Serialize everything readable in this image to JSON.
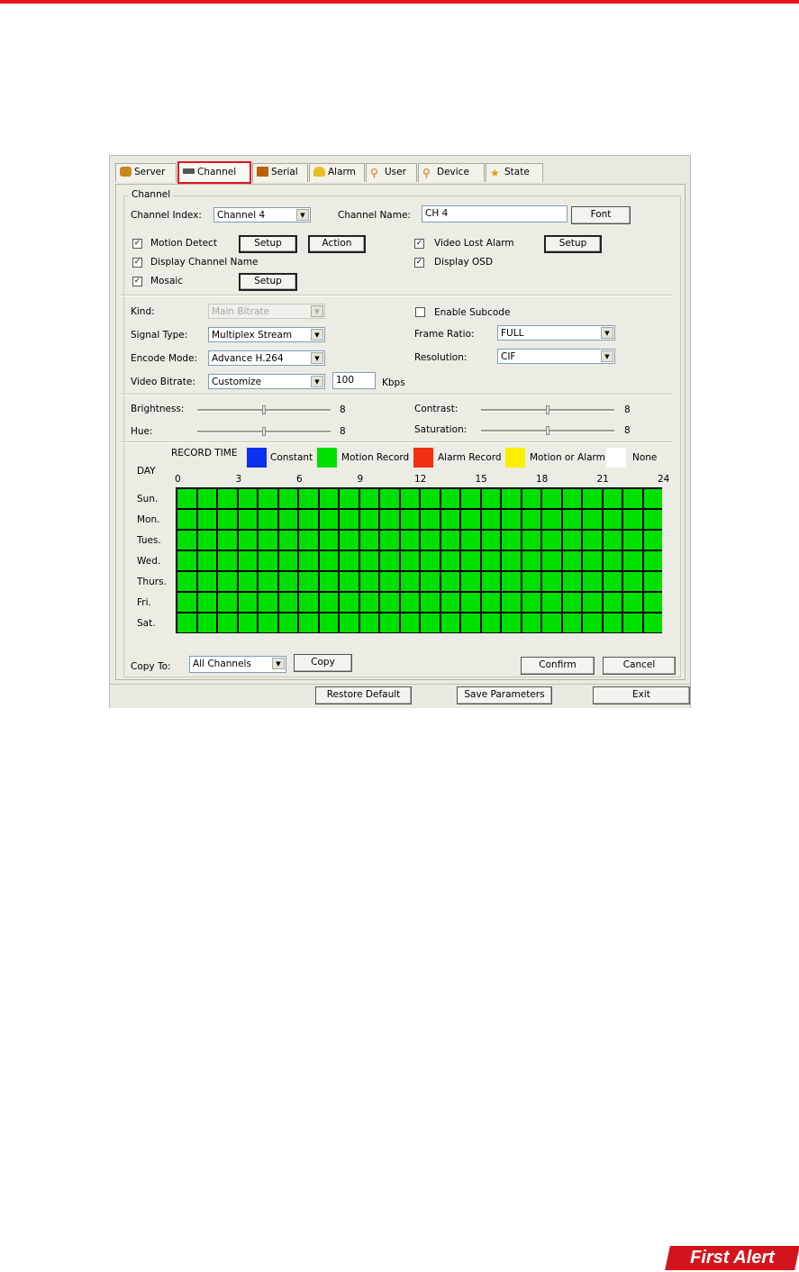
{
  "tabs": [
    {
      "label": "Server",
      "icon": "server-icon"
    },
    {
      "label": "Channel",
      "icon": "channel-icon"
    },
    {
      "label": "Serial",
      "icon": "serial-icon"
    },
    {
      "label": "Alarm",
      "icon": "alarm-icon"
    },
    {
      "label": "User",
      "icon": "user-icon"
    },
    {
      "label": "Device",
      "icon": "device-icon"
    },
    {
      "label": "State",
      "icon": "state-icon"
    }
  ],
  "active_tab": "Channel",
  "channel": {
    "group_title": "Channel",
    "index_label": "Channel Index:",
    "index_value": "Channel 4",
    "name_label": "Channel Name:",
    "name_value": "CH 4",
    "font_button": "Font",
    "motion_detect": {
      "label": "Motion Detect",
      "checked": true,
      "setup": "Setup",
      "action": "Action"
    },
    "display_channel_name": {
      "label": "Display Channel Name",
      "checked": true
    },
    "mosaic": {
      "label": "Mosaic",
      "checked": true,
      "setup": "Setup"
    },
    "video_lost_alarm": {
      "label": "Video Lost Alarm",
      "checked": true,
      "setup": "Setup"
    },
    "display_osd": {
      "label": "Display OSD",
      "checked": true
    }
  },
  "encode": {
    "kind_label": "Kind:",
    "kind_value": "Main Bitrate",
    "enable_subcode": {
      "label": "Enable Subcode",
      "checked": false
    },
    "signal_label": "Signal Type:",
    "signal_value": "Multiplex Stream",
    "frame_ratio_label": "Frame Ratio:",
    "frame_ratio_value": "FULL",
    "encode_mode_label": "Encode Mode:",
    "encode_mode_value": "Advance H.264",
    "resolution_label": "Resolution:",
    "resolution_value": "CIF",
    "bitrate_label": "Video Bitrate:",
    "bitrate_value": "Customize",
    "bitrate_number": "100",
    "bitrate_unit": "Kbps"
  },
  "image": {
    "brightness": {
      "label": "Brightness:",
      "value": "8",
      "level": 0.5
    },
    "contrast": {
      "label": "Contrast:",
      "value": "8",
      "level": 0.5
    },
    "hue": {
      "label": "Hue:",
      "value": "8",
      "level": 0.5
    },
    "saturation": {
      "label": "Saturation:",
      "value": "8",
      "level": 0.5
    }
  },
  "record": {
    "title": "RECORD TIME",
    "day_label": "DAY",
    "legend": [
      {
        "label": "Constant",
        "color": "#1030f0"
      },
      {
        "label": "Motion Record",
        "color": "#00e000"
      },
      {
        "label": "Alarm Record",
        "color": "#f03010"
      },
      {
        "label": "Motion or Alarm",
        "color": "#f8f000"
      },
      {
        "label": "None",
        "color": "#ffffff"
      }
    ],
    "hour_ticks": [
      "0",
      "3",
      "6",
      "9",
      "12",
      "15",
      "18",
      "21",
      "24"
    ],
    "days": [
      "Sun.",
      "Mon.",
      "Tues.",
      "Wed.",
      "Thurs.",
      "Fri.",
      "Sat."
    ],
    "cell_color": "#00e000"
  },
  "copy": {
    "label": "Copy To:",
    "value": "All Channels",
    "button": "Copy"
  },
  "confirm_button": "Confirm",
  "cancel_button": "Cancel",
  "footer": {
    "restore": "Restore Default",
    "save": "Save Parameters",
    "exit": "Exit"
  },
  "logo": "First Alert",
  "colors": {
    "accent": "#e8141c"
  }
}
